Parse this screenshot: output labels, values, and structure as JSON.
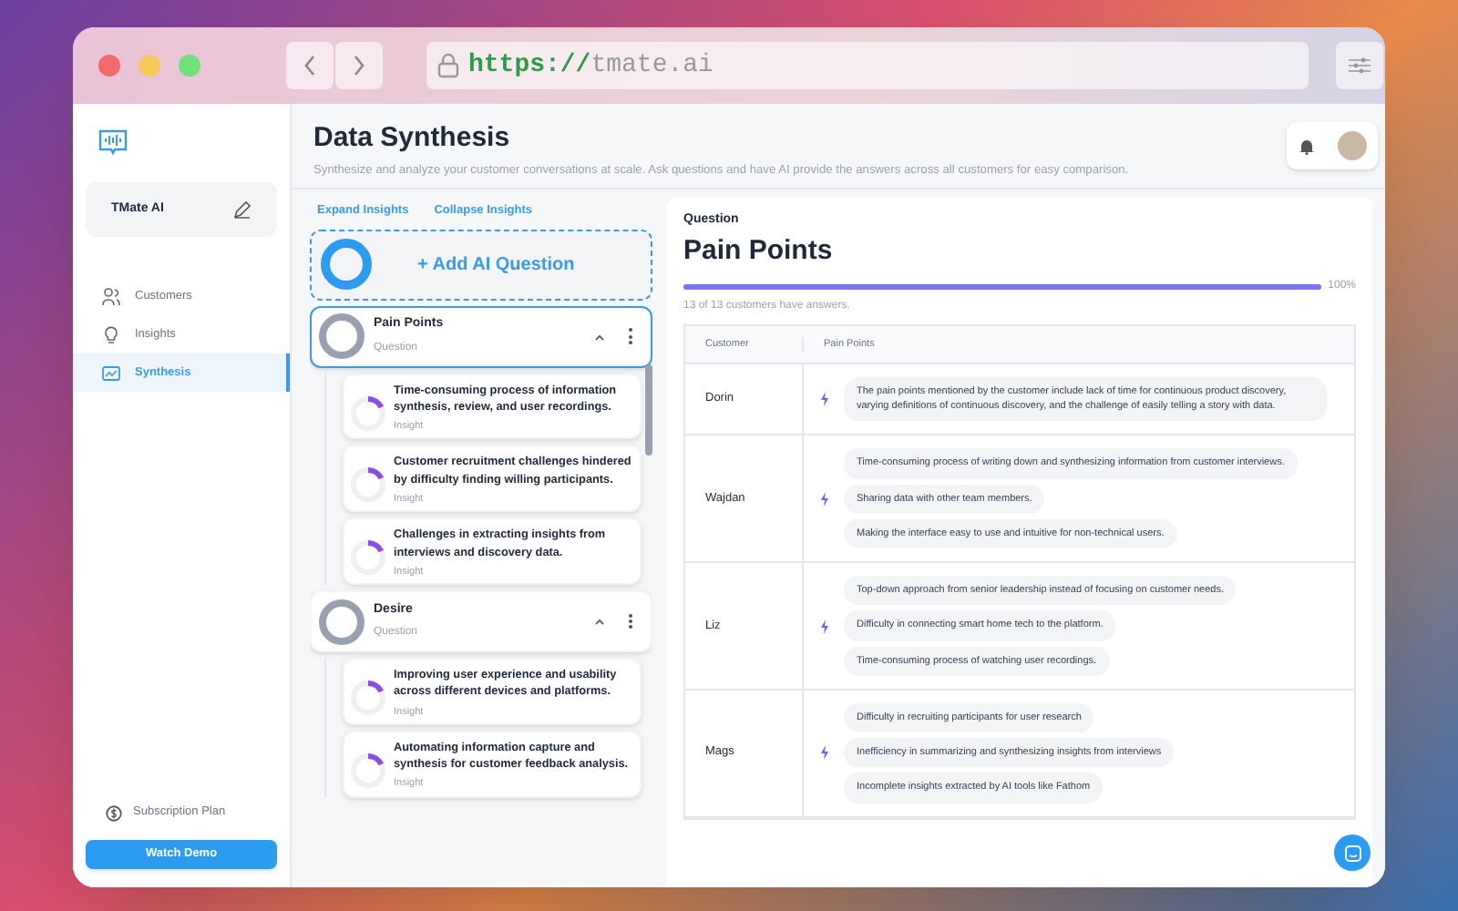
{
  "browser": {
    "url_scheme": "https://",
    "url_host": "tmate.ai"
  },
  "sidebar": {
    "workspace": "TMate AI",
    "items": [
      {
        "label": "Customers",
        "selected": false
      },
      {
        "label": "Insights",
        "selected": false
      },
      {
        "label": "Synthesis",
        "selected": true
      }
    ],
    "subscription": "Subscription Plan",
    "demo_button": "Watch Demo"
  },
  "header": {
    "title": "Data Synthesis",
    "subtitle": "Synthesize and analyze your customer conversations at scale. Ask questions and have AI provide the answers across all customers for easy comparison."
  },
  "toolbar": {
    "links": [
      "Expand Insights",
      "Collapse Insights"
    ],
    "add_button": "+ Add AI Question"
  },
  "questions": [
    {
      "title": "Pain Points",
      "type": "Question",
      "selected": true,
      "expanded": true,
      "insights": [
        {
          "text": "Time-consuming process of information synthesis, review, and user recordings.",
          "type": "Insight"
        },
        {
          "text": "Customer recruitment challenges hindered by difficulty finding willing participants.",
          "type": "Insight"
        },
        {
          "text": "Challenges in extracting insights from interviews and discovery data.",
          "type": "Insight"
        }
      ]
    },
    {
      "title": "Desire",
      "type": "Question",
      "selected": false,
      "expanded": true,
      "insights": [
        {
          "text": "Improving user experience and usability across different devices and platforms.",
          "type": "Insight"
        },
        {
          "text": "Automating information capture and synthesis for customer feedback analysis.",
          "type": "Insight"
        }
      ]
    }
  ],
  "detail": {
    "label": "Question",
    "title": "Pain Points",
    "progress": {
      "level": 1,
      "reading": "100%"
    },
    "summary": "13 of 13 customers have answers.",
    "table": {
      "columns": [
        "Customer",
        "Pain Points"
      ],
      "rows": [
        {
          "customer": "Dorin",
          "answers": [
            "The pain points mentioned by the customer include lack of time for continuous product discovery, varying definitions of continuous discovery, and the challenge of easily telling a story with data."
          ]
        },
        {
          "customer": "Wajdan",
          "answers": [
            "Time-consuming process of writing down and synthesizing information from customer interviews.",
            "Sharing data with other team members.",
            "Making the interface easy to use and intuitive for non-technical users."
          ]
        },
        {
          "customer": "Liz",
          "answers": [
            "Top-down approach from senior leadership instead of focusing on customer needs.",
            "Difficulty in connecting smart home tech to the platform.",
            "Time-consuming process of watching user recordings."
          ]
        },
        {
          "customer": "Mags",
          "answers": [
            "Difficulty in recruiting participants for user research",
            "Inefficiency in summarizing and synthesizing insights from interviews",
            "Incomplete insights extracted by AI tools like Fathom"
          ]
        }
      ]
    }
  }
}
